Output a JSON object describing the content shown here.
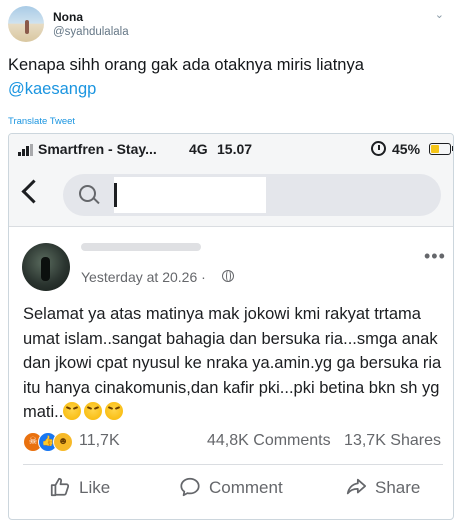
{
  "tweet": {
    "display_name": "Nona",
    "handle": "@syahdulalala",
    "text": "Kenapa sihh orang gak ada otaknya miris liatnya",
    "mention": "@kaesangp",
    "translate_label": "Translate Tweet"
  },
  "screenshot": {
    "status_bar": {
      "carrier": "Smartfren - Stay...",
      "network": "4G",
      "time": "15.07",
      "battery": "45%",
      "battery_level": 0.45
    },
    "post": {
      "timestamp": "Yesterday at 20.26 ·",
      "text": "Selamat ya atas matinya mak jokowi kmi rakyat trtama umat islam..sangat bahagia dan bersuka ria...smga anak dan jkowi cpat nyusul ke nraka ya.amin.yg ga bersuka ria itu hanya cinakomunis,dan kafir pki...pki betina bkn sh yg mati..",
      "reactions_count": "11,7K",
      "comments_count": "44,8K Comments",
      "shares_count": "13,7K Shares"
    },
    "actions": {
      "like": "Like",
      "comment": "Comment",
      "share": "Share"
    }
  },
  "colors": {
    "twitter_link": "#1b95e0",
    "fb_blue": "#1877f2",
    "angry": "#e9710f",
    "haha": "#f7b928"
  },
  "icons": [
    "chevron-down-icon",
    "signal-icon",
    "alarm-icon",
    "battery-icon",
    "back-arrow-icon",
    "search-icon",
    "globe-icon",
    "more-icon",
    "laughing-emoji-icon",
    "angry-reaction-icon",
    "like-reaction-icon",
    "haha-reaction-icon",
    "like-icon",
    "comment-icon",
    "share-icon"
  ]
}
